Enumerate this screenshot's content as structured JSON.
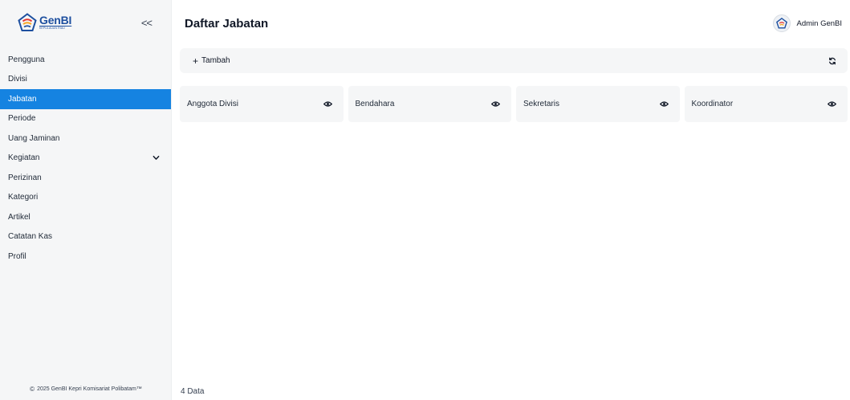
{
  "sidebar": {
    "brand": {
      "name": "GenBI",
      "subtitle": "KEPULAUAN RIAU"
    },
    "collapse_label": "<<",
    "items": [
      {
        "label": "Pengguna",
        "active": false,
        "has_submenu": false
      },
      {
        "label": "Divisi",
        "active": false,
        "has_submenu": false
      },
      {
        "label": "Jabatan",
        "active": true,
        "has_submenu": false
      },
      {
        "label": "Periode",
        "active": false,
        "has_submenu": false
      },
      {
        "label": "Uang Jaminan",
        "active": false,
        "has_submenu": false
      },
      {
        "label": "Kegiatan",
        "active": false,
        "has_submenu": true
      },
      {
        "label": "Perizinan",
        "active": false,
        "has_submenu": false
      },
      {
        "label": "Kategori",
        "active": false,
        "has_submenu": false
      },
      {
        "label": "Artikel",
        "active": false,
        "has_submenu": false
      },
      {
        "label": "Catatan Kas",
        "active": false,
        "has_submenu": false
      },
      {
        "label": "Profil",
        "active": false,
        "has_submenu": false
      }
    ],
    "footer": {
      "copyright_symbol": "©",
      "text": "2025 GenBI Kepri Komisariat Polibatam™"
    }
  },
  "header": {
    "title": "Daftar Jabatan",
    "user_name": "Admin GenBI"
  },
  "toolbar": {
    "add_label": "Tambah",
    "add_icon": "plus-icon",
    "refresh_icon": "refresh-icon"
  },
  "cards": [
    {
      "label": "Anggota Divisi",
      "icon": "eye-icon"
    },
    {
      "label": "Bendahara",
      "icon": "eye-icon"
    },
    {
      "label": "Sekretaris",
      "icon": "eye-icon"
    },
    {
      "label": "Koordinator",
      "icon": "eye-icon"
    }
  ],
  "footer": {
    "count_label": "4 Data"
  },
  "colors": {
    "accent": "#1583e1",
    "brand": "#1d4f9f",
    "panel": "#f5f6f7"
  }
}
